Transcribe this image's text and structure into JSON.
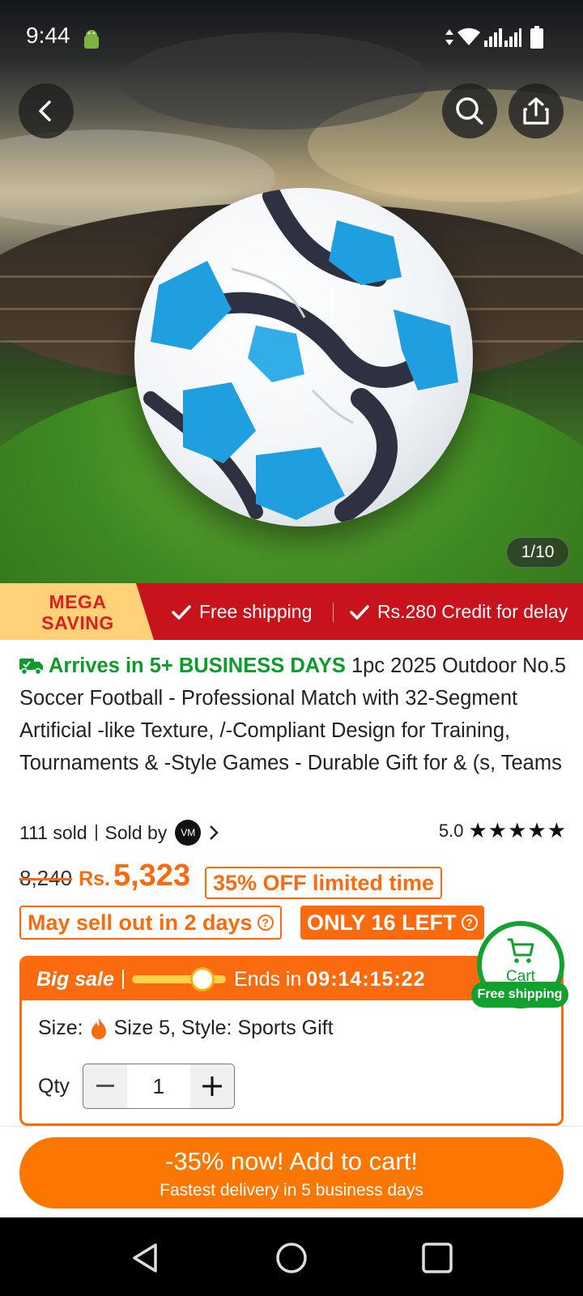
{
  "status": {
    "time": "9:44"
  },
  "gallery": {
    "counter": "1/10"
  },
  "banner": {
    "mega_line1": "MEGA",
    "mega_line2": "SAVING",
    "item1": "Free shipping",
    "item2": "Rs.280 Credit for delay"
  },
  "product": {
    "arrives": "Arrives in 5+ BUSINESS DAYS",
    "title": "1pc 2025 Outdoor No.5 Soccer Football - Professional Match with 32-Segment Artificial -like Texture, /-Compliant Design for Training, Tournaments & -Style Games - Durable Gift for & (s, Teams",
    "sold": "111 sold",
    "sold_by": "Sold by",
    "rating": "5.0",
    "stars": "★★★★★"
  },
  "price": {
    "old": "8,240",
    "currency": "Rs.",
    "current": "5,323",
    "discount": "35% OFF limited time",
    "sell_out": "May sell out in 2 days",
    "stock": "ONLY 16 LEFT"
  },
  "sale": {
    "label": "Big sale",
    "progress_fraction": 0.75,
    "ends_label": "Ends in",
    "timer": "09:14:15:22",
    "size_label": "Size:",
    "size_value": "Size 5, Style: Sports Gift",
    "qty_label": "Qty",
    "qty_value": "1"
  },
  "cart": {
    "label": "Cart",
    "badge": "Free shipping"
  },
  "cta": {
    "main": "-35% now! Add to cart!",
    "sub": "Fastest delivery in 5 business days"
  },
  "colors": {
    "accent": "#fb7701",
    "green": "#12a02f",
    "banner_red": "#c8121c"
  }
}
